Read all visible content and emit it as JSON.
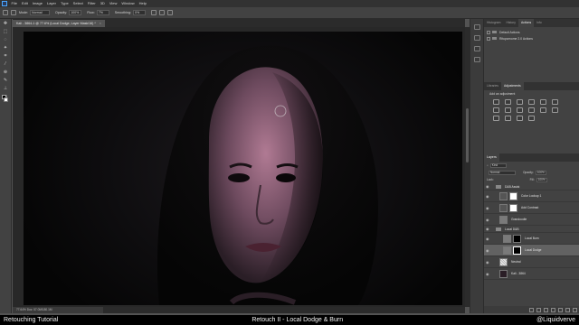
{
  "menubar": {
    "items": [
      "File",
      "Edit",
      "Image",
      "Layer",
      "Type",
      "Select",
      "Filter",
      "3D",
      "View",
      "Window",
      "Help"
    ]
  },
  "options": {
    "mode_label": "Mode:",
    "mode_value": "Normal",
    "opacity_label": "Opacity:",
    "opacity_value": "100%",
    "flow_label": "Flow:",
    "flow_value": "7%",
    "smoothing_label": "Smoothing:",
    "smoothing_value": "0%"
  },
  "document": {
    "tab_label": "Kali - 3864-1 @ 77.6% (Local Dodge, Layer Mask/16) *"
  },
  "statusbar": {
    "text": "77.64%   Doc: 57.0M/180.1M"
  },
  "panels": {
    "top_tabs": [
      "Histogram",
      "History",
      "Actions",
      "Info"
    ],
    "top_active": "Actions",
    "actions": [
      "Default Actions",
      "Rituparnome 2.0 Actions"
    ],
    "adj_tabs": [
      "Libraries",
      "Adjustments"
    ],
    "adj_active": "Adjustments",
    "adj_hint": "Add an adjustment",
    "layers_tab": "Layers",
    "search_kind": "Kind",
    "blend_mode": "Normal",
    "opacity_label": "Opacity:",
    "opacity_value": "100%",
    "lock_label": "Lock:",
    "fill_label": "Fill:",
    "fill_value": "100%",
    "layers": [
      {
        "name": "D&B Assist",
        "kind": "group"
      },
      {
        "name": "Color Lookup 1",
        "kind": "adjust"
      },
      {
        "name": "Add Contrast",
        "kind": "adjust"
      },
      {
        "name": "Grandoodle",
        "kind": "pixel"
      },
      {
        "name": "Local D&B",
        "kind": "group"
      },
      {
        "name": "Local Burn",
        "kind": "mask"
      },
      {
        "name": "Local Dodge",
        "kind": "mask-selected"
      },
      {
        "name": "Neutral",
        "kind": "pixel"
      },
      {
        "name": "Kali - 3864",
        "kind": "photo"
      }
    ]
  },
  "subtitles": {
    "left": "Retouching Tutorial",
    "center": "Retouch II - Local Dodge & Burn",
    "right": "@Liquidverve"
  },
  "colors": {
    "ps_bg": "#535353",
    "panel_bg": "#424242",
    "accent_blue": "#4aa8ff",
    "skin_tint": "#b07a93"
  }
}
